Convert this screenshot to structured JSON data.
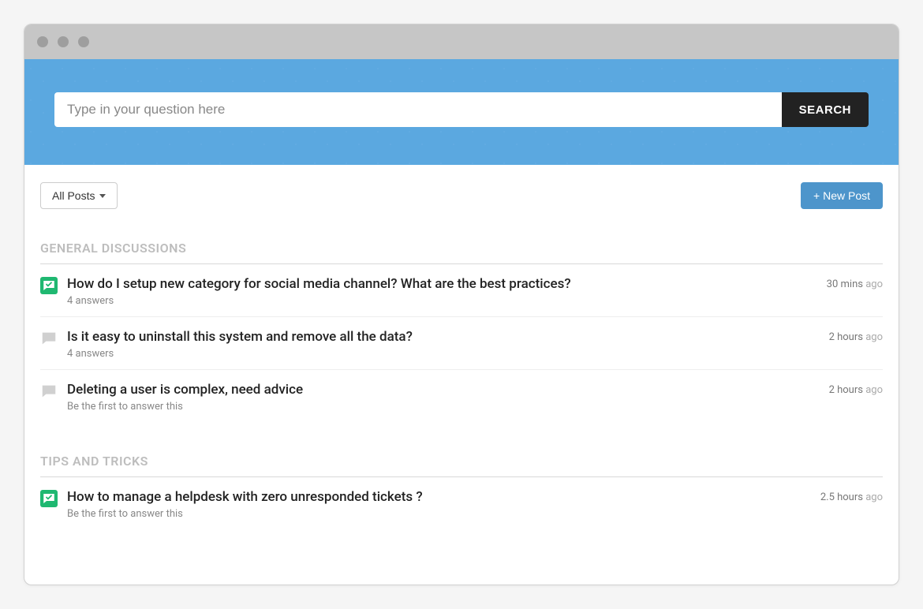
{
  "search": {
    "placeholder": "Type in your question here",
    "button": "SEARCH"
  },
  "toolbar": {
    "filter_label": "All Posts",
    "new_post_label": "+ New Post"
  },
  "time_suffix": "ago",
  "sections": [
    {
      "title": "GENERAL DISCUSSIONS",
      "posts": [
        {
          "status": "answered",
          "title": "How do I setup new category for social media channel? What are the best practices?",
          "meta": "4 answers",
          "time": "30 mins"
        },
        {
          "status": "unanswered",
          "title": "Is it easy to uninstall this system and remove all the data?",
          "meta": "4 answers",
          "time": "2 hours"
        },
        {
          "status": "unanswered",
          "title": "Deleting a user is complex, need advice",
          "meta": "Be the first to answer this",
          "time": "2 hours"
        }
      ]
    },
    {
      "title": "TIPS AND TRICKS",
      "posts": [
        {
          "status": "answered",
          "title": "How to manage a helpdesk with zero unresponded tickets ?",
          "meta": "Be the first to answer this",
          "time": "2.5 hours"
        }
      ]
    }
  ]
}
